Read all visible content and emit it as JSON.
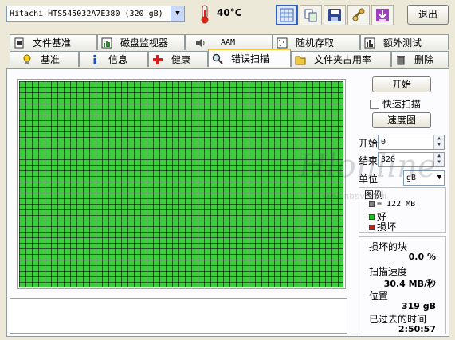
{
  "toolbar": {
    "drive": "Hitachi HTS545032A7E380  (320 gB)",
    "temperature": "40°C",
    "buttons": [
      "scan-mode-icon",
      "copy-icon",
      "save-icon",
      "tools-icon",
      "download-icon"
    ],
    "exit_label": "退出"
  },
  "tabs": {
    "row1": [
      "文件基准",
      "磁盘监视器",
      "AAM",
      "随机存取",
      "额外测试"
    ],
    "row2": [
      "基准",
      "信息",
      "健康",
      "错误扫描",
      "文件夹占用率",
      "删除"
    ],
    "active": "错误扫描"
  },
  "scan": {
    "start_button": "开始",
    "quick_scan_label": "快速扫描",
    "quick_scan_checked": false,
    "speed_map_button": "速度图",
    "start_label": "开始",
    "start_value": "0",
    "end_label": "结束",
    "end_value": "320",
    "unit_label": "单位",
    "unit_value": "gB"
  },
  "legend": {
    "title": "图例",
    "block_size": "= 122 MB",
    "good": "好",
    "damaged": "损坏",
    "colors": {
      "block": "#808080",
      "good": "#22c022",
      "damaged": "#c02020"
    }
  },
  "stats": {
    "damaged_label": "损坏的块",
    "damaged_value": "0.0 %",
    "speed_label": "扫描速度",
    "speed_value": "30.4 MB/秒",
    "position_label": "位置",
    "position_value": "319 gB",
    "elapsed_label": "已过去的时间",
    "elapsed_value": "2:50:57"
  },
  "watermark": {
    "line1": "Hlonline",
    "line2": "www.nbsv.com"
  }
}
